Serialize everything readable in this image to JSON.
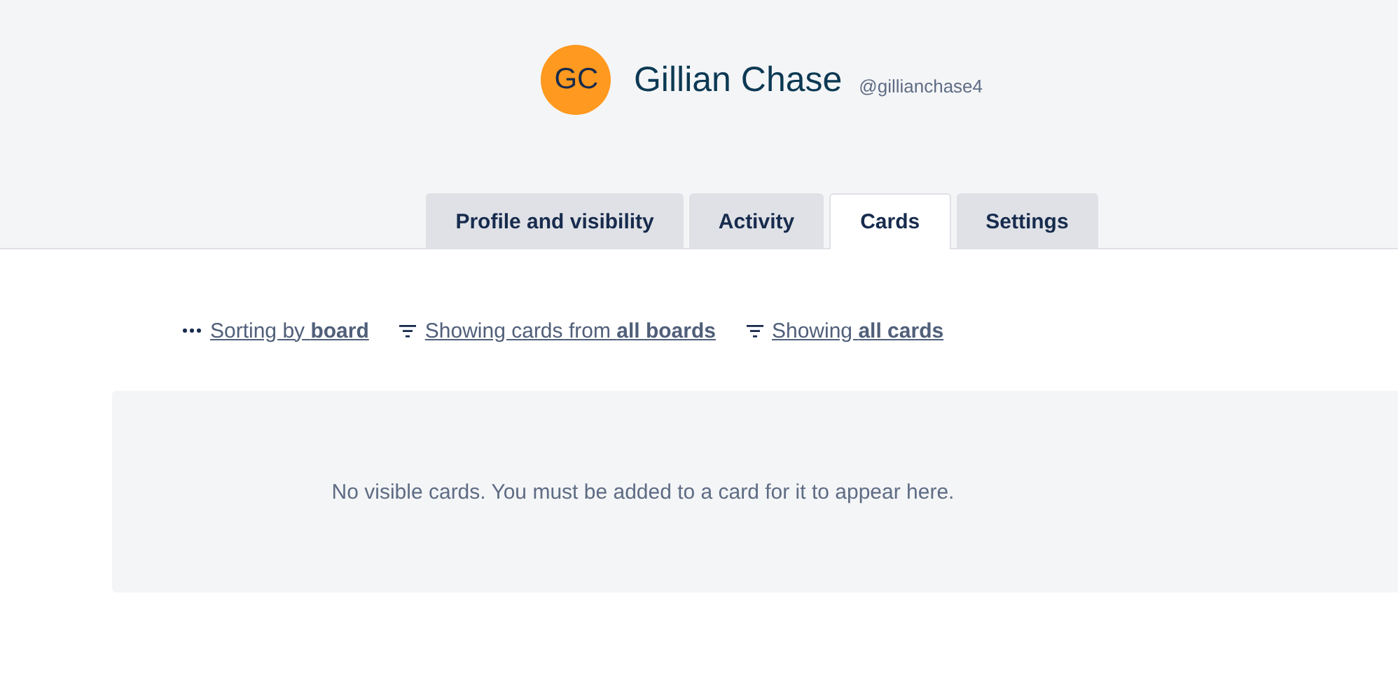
{
  "profile": {
    "initials": "GC",
    "name": "Gillian Chase",
    "username": "@gillianchase4"
  },
  "tabs": [
    {
      "label": "Profile and visibility",
      "selected": false
    },
    {
      "label": "Activity",
      "selected": false
    },
    {
      "label": "Cards",
      "selected": true
    },
    {
      "label": "Settings",
      "selected": false
    }
  ],
  "filters": [
    {
      "kind": "sort",
      "text": "Sorting by **board**"
    },
    {
      "kind": "filter",
      "text": "Showing cards from **all boards**"
    },
    {
      "kind": "filter",
      "text": "Showing **all cards**"
    }
  ],
  "empty_message": "No visible cards. You must be added to a card for it to appear here."
}
